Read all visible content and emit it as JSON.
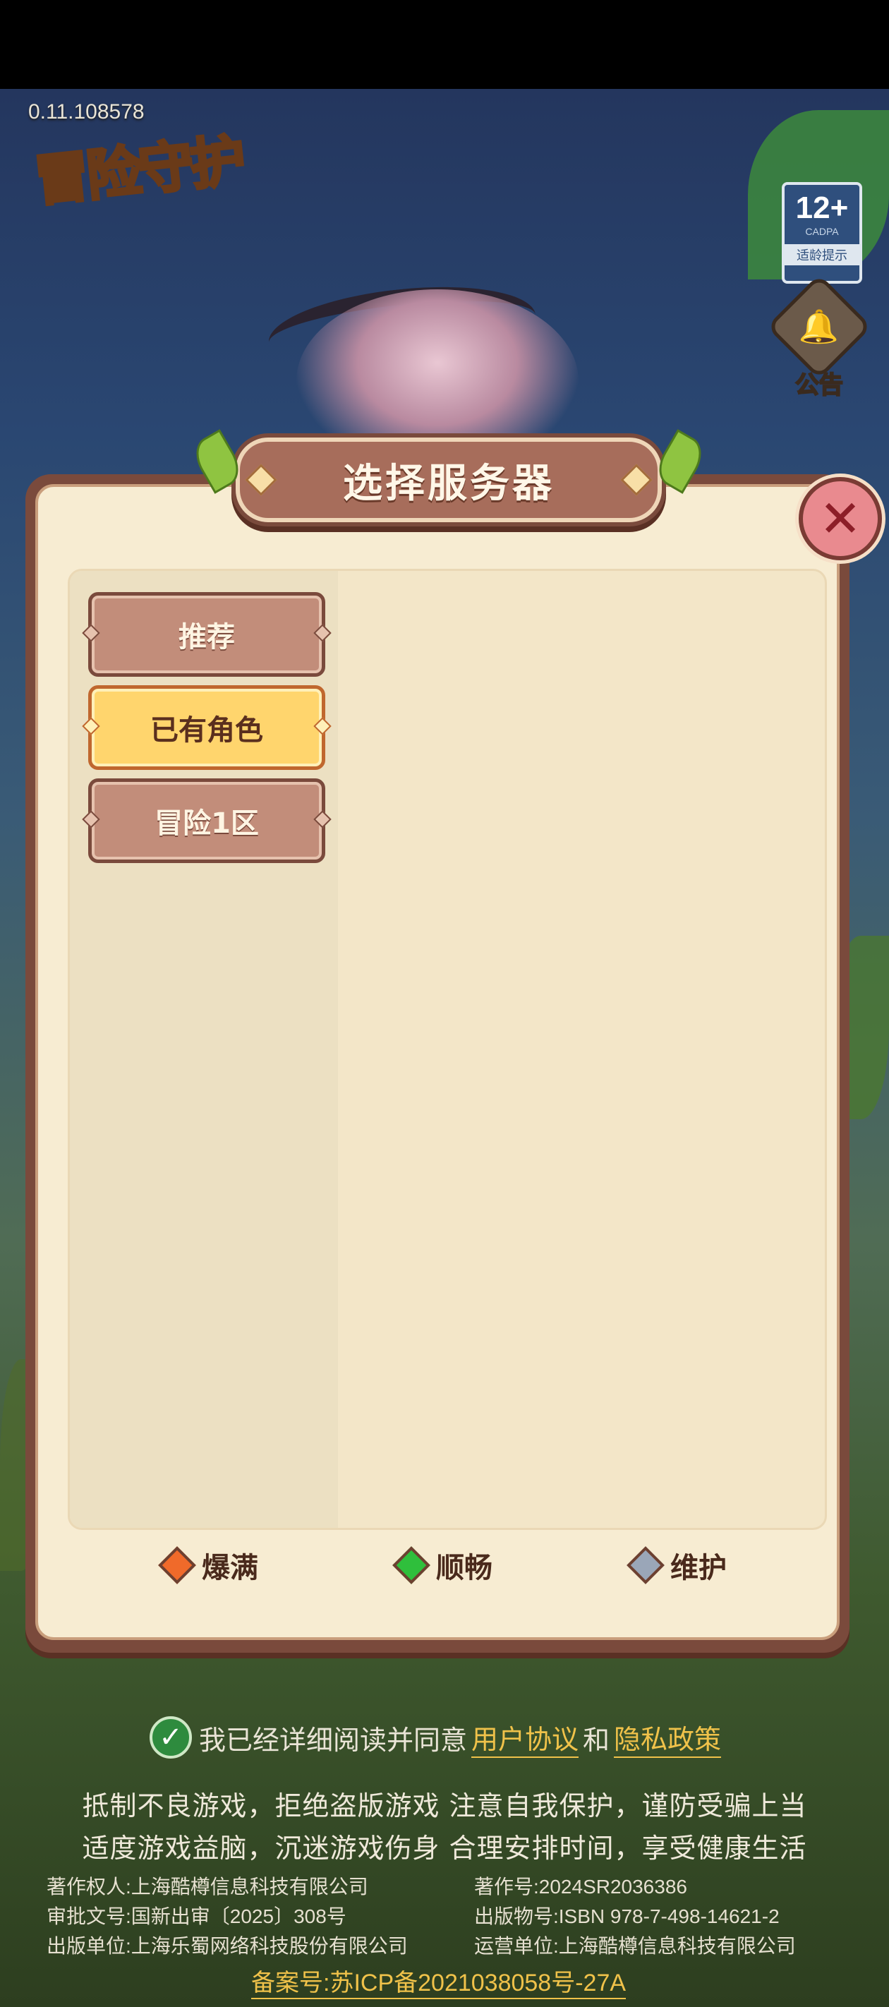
{
  "version": "0.11.108578",
  "logo_text": "冒险守护",
  "age_badge": {
    "rating": "12+",
    "org": "CADPA",
    "tip": "适龄提示"
  },
  "notice": {
    "label": "公告"
  },
  "dialog": {
    "title": "选择服务器",
    "tabs": [
      {
        "label": "推荐",
        "active": false
      },
      {
        "label": "已有角色",
        "active": true
      },
      {
        "label": "冒险1区",
        "active": false
      }
    ],
    "legend": [
      {
        "label": "爆满",
        "color": "#f06a2a"
      },
      {
        "label": "顺畅",
        "color": "#2fbf3c"
      },
      {
        "label": "维护",
        "color": "#9aa6b8"
      }
    ]
  },
  "agreement": {
    "prefix": "我已经详细阅读并同意",
    "user_agreement": "用户协议",
    "joiner": "和",
    "privacy_policy": "隐私政策"
  },
  "slogan": {
    "line1": "抵制不良游戏，拒绝盗版游戏 注意自我保护，谨防受骗上当",
    "line2": "适度游戏益脑，沉迷游戏伤身 合理安排时间，享受健康生活"
  },
  "info": {
    "copyright_owner": "著作权人:上海酷樽信息科技有限公司",
    "copyright_no": "著作号:2024SR2036386",
    "approval_no": "审批文号:国新出审〔2025〕308号",
    "publication_no": "出版物号:ISBN 978-7-498-14621-2",
    "publisher": "出版单位:上海乐蜀网络科技股份有限公司",
    "operator": "运营单位:上海酷樽信息科技有限公司",
    "icp": "备案号:苏ICP备2021038058号-27A"
  }
}
